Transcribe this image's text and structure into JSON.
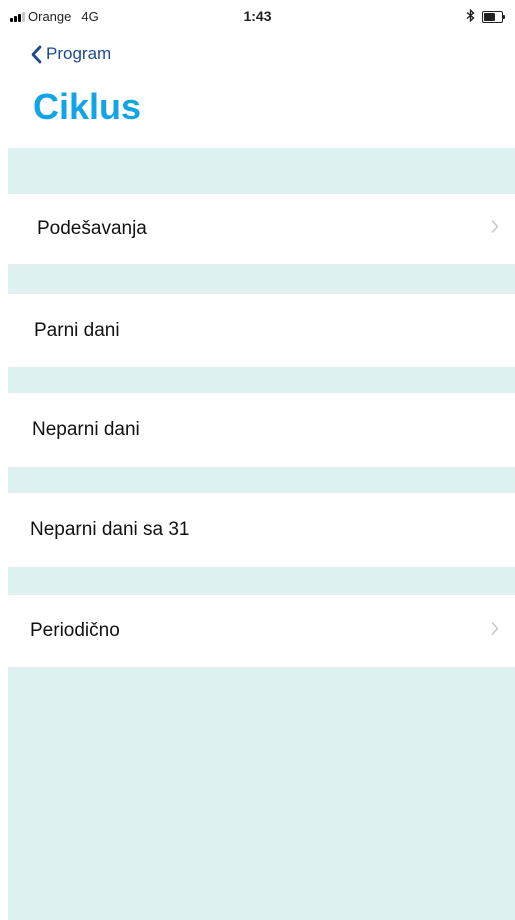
{
  "status_bar": {
    "carrier": "Orange",
    "network": "4G",
    "time": "1:43",
    "icons": [
      "signal-icon",
      "bluetooth-icon",
      "battery-icon"
    ]
  },
  "nav": {
    "back_label": "Program",
    "back_icon": "chevron-left-icon"
  },
  "title": "Ciklus",
  "colors": {
    "title": "#12a4e6",
    "back": "#1a4b8f",
    "background": "#e0f1f2"
  },
  "menu": {
    "items": [
      {
        "label": "Podešavanja",
        "chevron": true
      },
      {
        "label": "Parni dani",
        "chevron": false
      },
      {
        "label": "Neparni dani",
        "chevron": false
      },
      {
        "label": "Neparni dani sa 31",
        "chevron": false
      },
      {
        "label": "Periodično",
        "chevron": true
      }
    ]
  }
}
